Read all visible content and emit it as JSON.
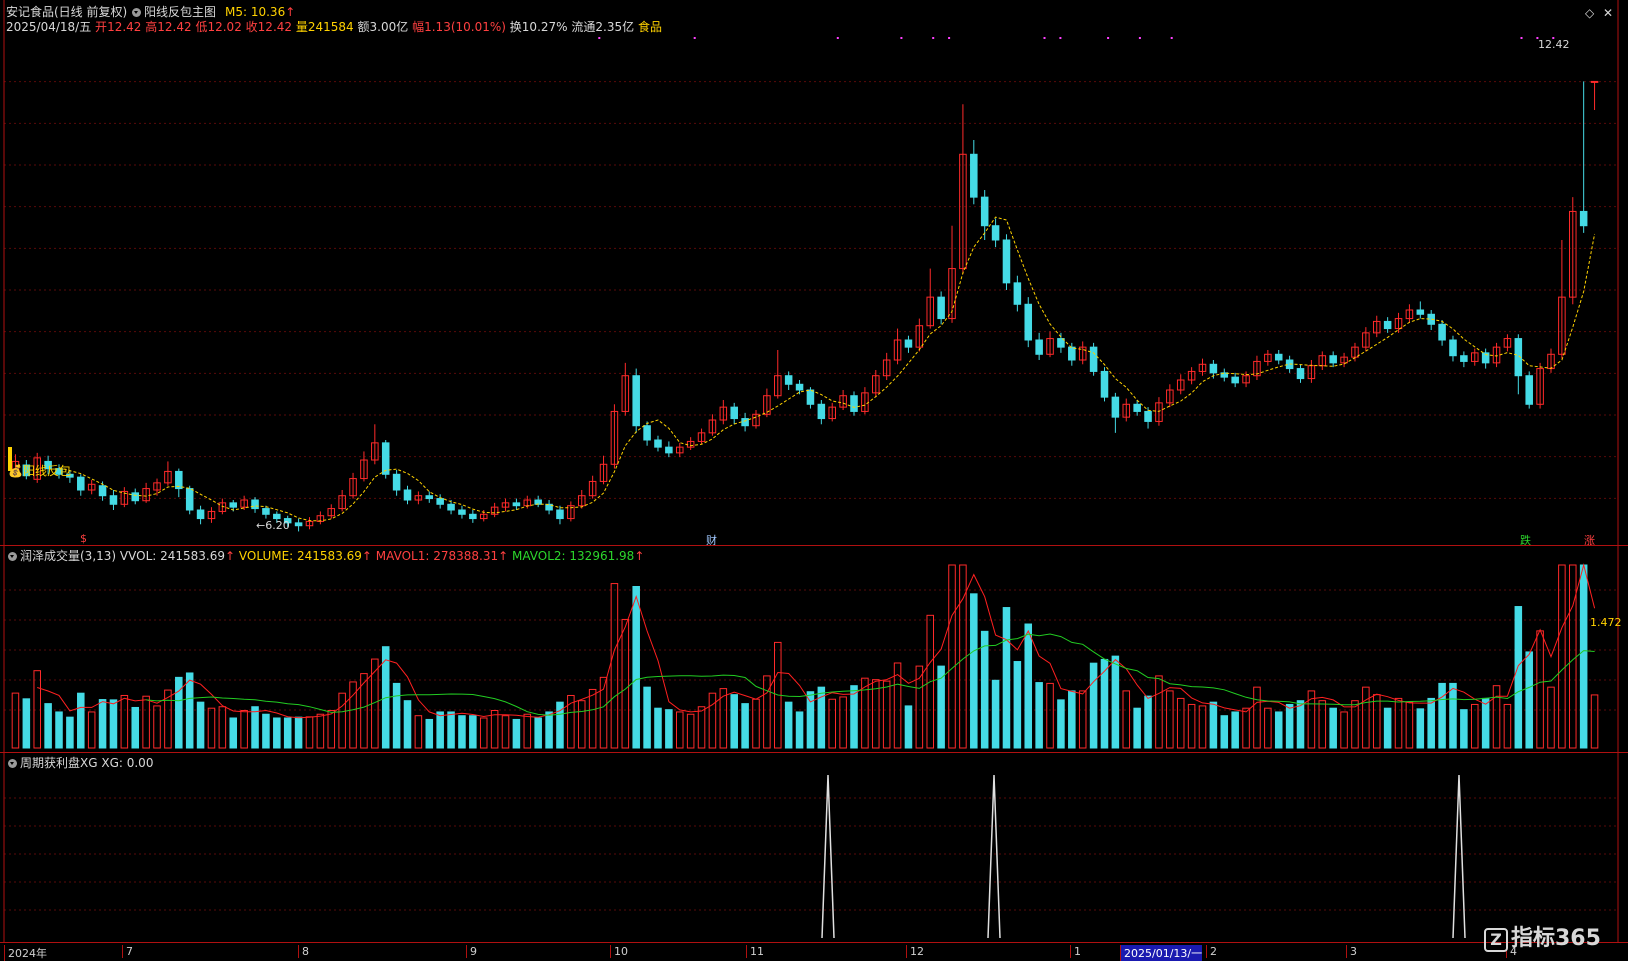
{
  "header": {
    "stock_name": "安记食品(日线 前复权)",
    "indicator_name": "阳线反包主图",
    "ma5_label": "M5: 10.36",
    "arrow_up": "↑",
    "date": "2025/04/18/五",
    "open_label": "开",
    "open": "12.42",
    "high_label": "高",
    "high": "12.42",
    "low_label": "低",
    "low": "12.02",
    "close_label": "收",
    "close": "12.42",
    "volume_label": "量",
    "volume": "241584",
    "amount_label": "额",
    "amount": "3.00亿",
    "change_label": "幅",
    "change": "1.13(10.01%)",
    "turnover_label": "换",
    "turnover": "10.27%",
    "float_label": "流通",
    "float": "2.35亿",
    "sector": "食品"
  },
  "main_chart": {
    "legend_signal": "阳线反包",
    "low_marker": "6.20",
    "high_marker": "12.42",
    "badges": {
      "s": "$",
      "cai": "财",
      "die": "跌",
      "zhang": "涨"
    }
  },
  "volume_panel": {
    "title": "润泽成交量(3,13)",
    "vvol": "VVOL: 241583.69",
    "volume": "VOLUME: 241583.69",
    "mavol1": "MAVOL1: 278388.31",
    "mavol2": "MAVOL2: 132961.98",
    "right_value": "1.472"
  },
  "xg_panel": {
    "title": "周期获利盘XG",
    "xg": "XG: 0.00"
  },
  "time_axis": [
    "2024年",
    "7",
    "8",
    "9",
    "10",
    "11",
    "12",
    "1",
    "2025/01/13/一",
    "2",
    "3",
    "4"
  ],
  "watermark": "指标365",
  "colors": {
    "up": "#ff2a2a",
    "down": "#45dbe6",
    "ma5": "#ffd200",
    "mavol1": "#ff2020",
    "mavol2": "#22cc22",
    "separator": "#b01010"
  },
  "chart_data": {
    "type": "candlestick",
    "candles": [
      [
        6.95,
        7.1,
        7.2,
        6.88
      ],
      [
        7.05,
        6.9,
        7.12,
        6.85
      ],
      [
        6.85,
        7.15,
        7.22,
        6.8
      ],
      [
        7.1,
        7.0,
        7.18,
        6.92
      ],
      [
        7.0,
        6.92,
        7.06,
        6.86
      ],
      [
        6.92,
        6.88,
        6.98,
        6.8
      ],
      [
        6.88,
        6.7,
        6.92,
        6.62
      ],
      [
        6.7,
        6.78,
        6.84,
        6.64
      ],
      [
        6.76,
        6.62,
        6.82,
        6.55
      ],
      [
        6.62,
        6.5,
        6.7,
        6.42
      ],
      [
        6.5,
        6.68,
        6.74,
        6.46
      ],
      [
        6.66,
        6.55,
        6.72,
        6.5
      ],
      [
        6.55,
        6.72,
        6.8,
        6.52
      ],
      [
        6.7,
        6.8,
        6.86,
        6.62
      ],
      [
        6.8,
        6.96,
        7.1,
        6.76
      ],
      [
        6.96,
        6.72,
        7.0,
        6.6
      ],
      [
        6.72,
        6.42,
        6.76,
        6.36
      ],
      [
        6.42,
        6.3,
        6.48,
        6.22
      ],
      [
        6.3,
        6.4,
        6.46,
        6.24
      ],
      [
        6.4,
        6.52,
        6.58,
        6.36
      ],
      [
        6.52,
        6.46,
        6.56,
        6.4
      ],
      [
        6.46,
        6.56,
        6.62,
        6.42
      ],
      [
        6.56,
        6.44,
        6.6,
        6.38
      ],
      [
        6.44,
        6.36,
        6.48,
        6.3
      ],
      [
        6.36,
        6.3,
        6.4,
        6.24
      ],
      [
        6.3,
        6.24,
        6.34,
        6.18
      ],
      [
        6.24,
        6.2,
        6.3,
        6.12
      ],
      [
        6.2,
        6.26,
        6.32,
        6.15
      ],
      [
        6.26,
        6.34,
        6.4,
        6.22
      ],
      [
        6.34,
        6.44,
        6.5,
        6.3
      ],
      [
        6.44,
        6.62,
        6.7,
        6.4
      ],
      [
        6.62,
        6.86,
        6.94,
        6.58
      ],
      [
        6.86,
        7.12,
        7.24,
        6.82
      ],
      [
        7.12,
        7.36,
        7.62,
        7.06
      ],
      [
        7.36,
        6.92,
        7.4,
        6.86
      ],
      [
        6.92,
        6.7,
        6.98,
        6.62
      ],
      [
        6.7,
        6.56,
        6.76,
        6.5
      ],
      [
        6.56,
        6.62,
        6.68,
        6.5
      ],
      [
        6.62,
        6.58,
        6.68,
        6.52
      ],
      [
        6.58,
        6.5,
        6.64,
        6.44
      ],
      [
        6.5,
        6.42,
        6.56,
        6.36
      ],
      [
        6.42,
        6.36,
        6.48,
        6.3
      ],
      [
        6.36,
        6.3,
        6.42,
        6.24
      ],
      [
        6.3,
        6.36,
        6.42,
        6.26
      ],
      [
        6.36,
        6.46,
        6.52,
        6.32
      ],
      [
        6.46,
        6.52,
        6.58,
        6.4
      ],
      [
        6.52,
        6.48,
        6.58,
        6.42
      ],
      [
        6.48,
        6.56,
        6.62,
        6.44
      ],
      [
        6.56,
        6.5,
        6.62,
        6.46
      ],
      [
        6.5,
        6.42,
        6.56,
        6.36
      ],
      [
        6.42,
        6.3,
        6.48,
        6.22
      ],
      [
        6.3,
        6.48,
        6.54,
        6.26
      ],
      [
        6.48,
        6.62,
        6.7,
        6.44
      ],
      [
        6.62,
        6.82,
        6.9,
        6.58
      ],
      [
        6.82,
        7.06,
        7.18,
        6.78
      ],
      [
        7.06,
        7.8,
        7.9,
        7.0
      ],
      [
        7.8,
        8.3,
        8.48,
        7.74
      ],
      [
        8.3,
        7.6,
        8.4,
        7.5
      ],
      [
        7.6,
        7.4,
        7.66,
        7.32
      ],
      [
        7.4,
        7.3,
        7.46,
        7.24
      ],
      [
        7.3,
        7.22,
        7.38,
        7.16
      ],
      [
        7.22,
        7.3,
        7.36,
        7.16
      ],
      [
        7.3,
        7.38,
        7.44,
        7.26
      ],
      [
        7.38,
        7.5,
        7.56,
        7.34
      ],
      [
        7.5,
        7.68,
        7.76,
        7.46
      ],
      [
        7.68,
        7.86,
        7.96,
        7.62
      ],
      [
        7.86,
        7.7,
        7.92,
        7.62
      ],
      [
        7.7,
        7.6,
        7.78,
        7.52
      ],
      [
        7.6,
        7.76,
        7.82,
        7.56
      ],
      [
        7.76,
        8.02,
        8.12,
        7.72
      ],
      [
        8.02,
        8.3,
        8.66,
        7.98
      ],
      [
        8.3,
        8.18,
        8.36,
        8.1
      ],
      [
        8.18,
        8.1,
        8.24,
        8.04
      ],
      [
        8.1,
        7.9,
        8.14,
        7.84
      ],
      [
        7.9,
        7.7,
        7.96,
        7.62
      ],
      [
        7.7,
        7.86,
        7.92,
        7.66
      ],
      [
        7.86,
        8.02,
        8.1,
        7.82
      ],
      [
        8.02,
        7.8,
        8.08,
        7.74
      ],
      [
        7.8,
        8.06,
        8.14,
        7.76
      ],
      [
        8.06,
        8.3,
        8.38,
        8.0
      ],
      [
        8.3,
        8.52,
        8.62,
        8.24
      ],
      [
        8.52,
        8.8,
        8.96,
        8.46
      ],
      [
        8.8,
        8.7,
        8.86,
        8.62
      ],
      [
        8.7,
        9.0,
        9.1,
        8.64
      ],
      [
        9.0,
        9.4,
        9.8,
        8.96
      ],
      [
        9.4,
        9.1,
        9.48,
        9.02
      ],
      [
        9.1,
        9.8,
        10.4,
        9.04
      ],
      [
        9.8,
        11.4,
        12.1,
        9.72
      ],
      [
        11.4,
        10.8,
        11.6,
        10.7
      ],
      [
        10.8,
        10.4,
        10.9,
        10.2
      ],
      [
        10.4,
        10.2,
        10.5,
        10.1
      ],
      [
        10.2,
        9.6,
        10.28,
        9.5
      ],
      [
        9.6,
        9.3,
        9.7,
        9.2
      ],
      [
        9.3,
        8.8,
        9.4,
        8.7
      ],
      [
        8.8,
        8.6,
        8.9,
        8.52
      ],
      [
        8.6,
        8.82,
        8.92,
        8.56
      ],
      [
        8.82,
        8.7,
        8.9,
        8.62
      ],
      [
        8.7,
        8.52,
        8.76,
        8.44
      ],
      [
        8.52,
        8.7,
        8.78,
        8.46
      ],
      [
        8.7,
        8.36,
        8.76,
        8.3
      ],
      [
        8.36,
        8.0,
        8.42,
        7.94
      ],
      [
        8.0,
        7.72,
        8.06,
        7.5
      ],
      [
        7.72,
        7.9,
        7.98,
        7.66
      ],
      [
        7.9,
        7.8,
        7.96,
        7.74
      ],
      [
        7.8,
        7.66,
        7.86,
        7.56
      ],
      [
        7.66,
        7.92,
        8.0,
        7.6
      ],
      [
        7.92,
        8.1,
        8.18,
        7.86
      ],
      [
        8.1,
        8.24,
        8.32,
        8.04
      ],
      [
        8.24,
        8.36,
        8.42,
        8.18
      ],
      [
        8.36,
        8.46,
        8.54,
        8.3
      ],
      [
        8.46,
        8.34,
        8.52,
        8.26
      ],
      [
        8.34,
        8.28,
        8.4,
        8.22
      ],
      [
        8.28,
        8.2,
        8.34,
        8.14
      ],
      [
        8.2,
        8.3,
        8.36,
        8.14
      ],
      [
        8.3,
        8.5,
        8.58,
        8.24
      ],
      [
        8.5,
        8.6,
        8.66,
        8.44
      ],
      [
        8.6,
        8.52,
        8.66,
        8.46
      ],
      [
        8.52,
        8.4,
        8.58,
        8.34
      ],
      [
        8.4,
        8.26,
        8.46,
        8.2
      ],
      [
        8.26,
        8.44,
        8.52,
        8.2
      ],
      [
        8.44,
        8.58,
        8.64,
        8.38
      ],
      [
        8.58,
        8.48,
        8.64,
        8.42
      ],
      [
        8.48,
        8.56,
        8.62,
        8.42
      ],
      [
        8.56,
        8.7,
        8.76,
        8.5
      ],
      [
        8.7,
        8.9,
        8.98,
        8.64
      ],
      [
        8.9,
        9.06,
        9.14,
        8.84
      ],
      [
        9.06,
        8.96,
        9.12,
        8.9
      ],
      [
        8.96,
        9.1,
        9.18,
        8.9
      ],
      [
        9.1,
        9.22,
        9.3,
        9.04
      ],
      [
        9.22,
        9.16,
        9.34,
        9.1
      ],
      [
        9.16,
        9.02,
        9.22,
        8.94
      ],
      [
        9.02,
        8.8,
        9.08,
        8.72
      ],
      [
        8.8,
        8.58,
        8.86,
        8.5
      ],
      [
        8.58,
        8.5,
        8.64,
        8.42
      ],
      [
        8.5,
        8.62,
        8.68,
        8.44
      ],
      [
        8.62,
        8.48,
        8.68,
        8.4
      ],
      [
        8.48,
        8.7,
        8.76,
        8.42
      ],
      [
        8.7,
        8.82,
        8.88,
        8.64
      ],
      [
        8.82,
        8.3,
        8.88,
        8.04
      ],
      [
        8.3,
        7.9,
        8.36,
        7.84
      ],
      [
        7.9,
        8.4,
        8.48,
        7.84
      ],
      [
        8.4,
        8.6,
        8.68,
        8.34
      ],
      [
        8.6,
        9.4,
        10.2,
        8.54
      ],
      [
        9.4,
        10.6,
        10.8,
        9.3
      ],
      [
        10.6,
        10.4,
        12.42,
        10.3
      ],
      [
        12.42,
        12.42,
        12.42,
        12.02
      ]
    ],
    "price_range": [
      6.0,
      13.0
    ],
    "volume_note": "volume bars follow candle colors"
  }
}
